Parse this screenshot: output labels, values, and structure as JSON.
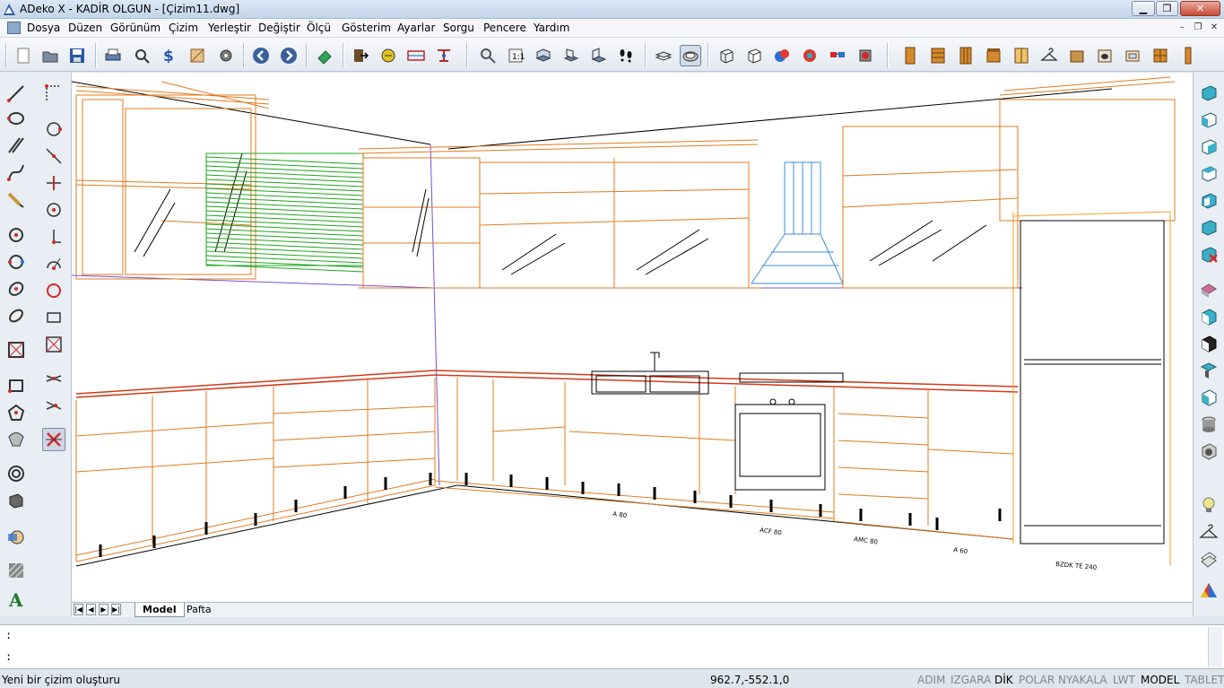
{
  "window": {
    "title": "ADeko X - KADİR OLGUN - [Çizim11.dwg]",
    "buttons": {
      "minimize": "▁",
      "maximize": "❐",
      "close": "✕"
    }
  },
  "menu": {
    "items": [
      "Dosya",
      "Düzen",
      "Görünüm",
      "Çizim",
      "Yerleştir",
      "Değiştir",
      "Ölçü",
      "Gösterim",
      "Ayarlar",
      "Sorgu",
      "Pencere",
      "Yardım"
    ],
    "mdi_buttons": {
      "minimize": "–",
      "restore": "❐",
      "close": "✕"
    }
  },
  "toolbar": {
    "icons": [
      "new-file-icon",
      "open-folder-icon",
      "save-icon",
      "print-icon",
      "print-preview-icon",
      "cost-icon",
      "render-icon",
      "settings-icon",
      "back-icon",
      "forward-icon",
      "eraser-icon",
      "export-icon",
      "layer-icon",
      "dimension-icon",
      "grip-icon",
      "zoom-icon",
      "zoom-window-icon",
      "view-top-icon",
      "view-front-icon",
      "view-side-icon",
      "view-iso-icon",
      "footprints-icon",
      "layer-stack-icon",
      "view-3d-icon",
      "wireframe-icon",
      "hidden-icon",
      "shaded-icon",
      "realistic-icon",
      "glasses-icon",
      "render-3d-icon",
      "door-icon",
      "drawer-icon",
      "cabinet-icon",
      "counter-icon",
      "panel-icon",
      "hanger-icon",
      "shelf-icon",
      "oven-icon",
      "sink-icon",
      "grid-icon",
      "column-icon"
    ]
  },
  "left_tools": {
    "icons": [
      "line-icon",
      "polyline-icon",
      "multiline-icon",
      "spline-icon",
      "freehand-icon",
      "circle-icon",
      "ellipse-icon",
      "arc-icon",
      "donut-icon",
      "block-icon",
      "rectangle-icon",
      "polygon-icon",
      "region-icon",
      "revcloud-icon",
      "hatch-icon",
      "text-icon"
    ],
    "icons2": [
      "dashed-rect-icon",
      "circle2-icon",
      "line2-icon",
      "break-icon",
      "target-icon",
      "point-icon",
      "arc2-icon",
      "circle3-icon",
      "rectangle2-icon",
      "cross-box-icon",
      "cross-icon",
      "trim-icon",
      "delete-icon"
    ]
  },
  "right_tools": {
    "icons": [
      "view-ne-icon",
      "view-nw-icon",
      "view-se-icon",
      "view-sw-icon",
      "view-front2-icon",
      "view-back-icon",
      "view-close-icon",
      "view-top2-icon",
      "cube-front-icon",
      "cube-dark-icon",
      "cube-side-icon",
      "cube-cut-icon",
      "cube-cyl-icon",
      "cube-gear-icon",
      "cube-bulb-icon",
      "hanger2-icon",
      "paper-icon",
      "prism-icon"
    ]
  },
  "drawing": {
    "labels": {
      "a80": "A 80",
      "acf80": "ACF 80",
      "amc80": "AMC 80",
      "a60": "A 60",
      "fridge": "BZDK TE 240"
    }
  },
  "tabs": {
    "items": [
      "Model",
      "Pafta"
    ],
    "active": "Model",
    "nav": [
      "|◀",
      "◀",
      "▶",
      "▶|"
    ]
  },
  "command": {
    "line1": ":",
    "line2": ":"
  },
  "status": {
    "prompt": "Yeni bir çizim oluşturu",
    "coords": "962.7,-552.1,0",
    "toggles": [
      {
        "label": "ADIM",
        "on": false
      },
      {
        "label": "IZGARA",
        "on": false
      },
      {
        "label": "DİK",
        "on": true
      },
      {
        "label": "POLAR",
        "on": false
      },
      {
        "label": "NYAKALA",
        "on": false
      },
      {
        "label": "LWT",
        "on": false
      },
      {
        "label": "MODEL",
        "on": true
      },
      {
        "label": "TABLET",
        "on": false
      }
    ]
  },
  "colors": {
    "cabinet": "#e07b1f",
    "countertop": "#d23a1a",
    "blind": "#1ea51e",
    "hood": "#3a8fd8",
    "wall": "#7a4fd1"
  }
}
